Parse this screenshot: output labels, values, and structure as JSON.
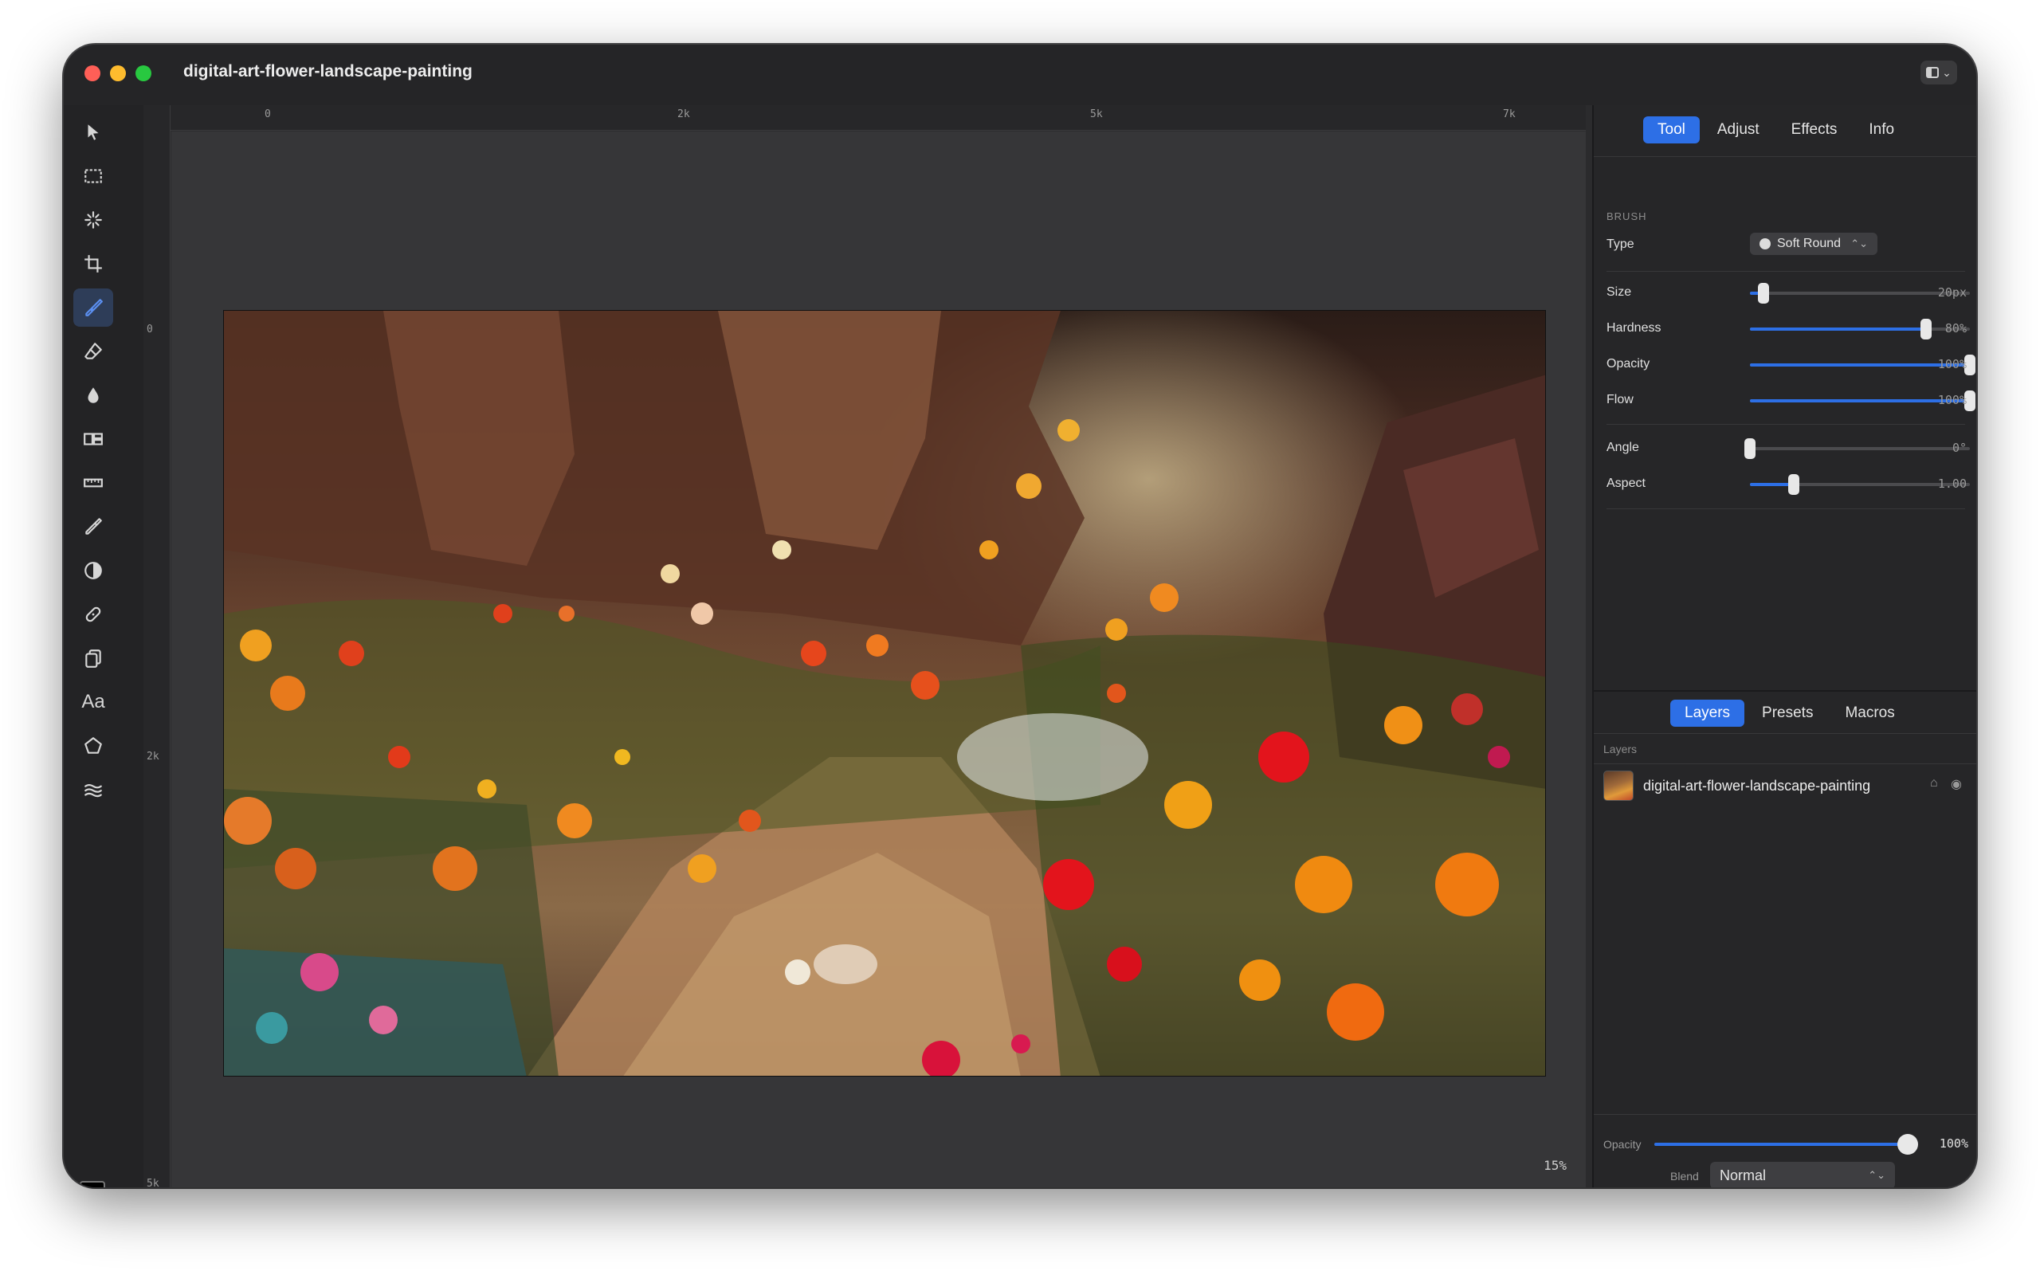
{
  "window": {
    "title": "digital-art-flower-landscape-painting"
  },
  "rulers": {
    "horizontal": [
      "0",
      "2k",
      "5k",
      "7k"
    ],
    "vertical": [
      "0",
      "2k",
      "5k"
    ]
  },
  "canvas": {
    "zoom": "15%"
  },
  "inspector": {
    "tabs": [
      "Tool",
      "Adjust",
      "Effects",
      "Info"
    ],
    "active_tab": "Tool",
    "section": "BRUSH",
    "type_label": "Type",
    "type_value": "Soft Round",
    "params": [
      {
        "label": "Size",
        "value": "20px",
        "level": 0.06
      },
      {
        "label": "Hardness",
        "value": "80%",
        "level": 0.8
      },
      {
        "label": "Opacity",
        "value": "100%",
        "level": 1.0
      },
      {
        "label": "Flow",
        "value": "100%",
        "level": 1.0
      },
      {
        "label": "Angle",
        "value": "0°",
        "level": 0.0
      },
      {
        "label": "Aspect",
        "value": "1.00",
        "level": 0.2
      }
    ]
  },
  "layers_panel": {
    "tabs": [
      "Layers",
      "Presets",
      "Macros"
    ],
    "active_tab": "Layers",
    "header": "Layers",
    "layers": [
      {
        "name": "digital-art-flower-landscape-painting"
      }
    ],
    "opacity_label": "Opacity",
    "opacity_value": "100%",
    "opacity_level": 1.0,
    "blend_label": "Blend",
    "blend_value": "Normal"
  },
  "colors": {
    "accent": "#2d6fe6",
    "foreground": "#000000",
    "background": "#ffffff"
  }
}
